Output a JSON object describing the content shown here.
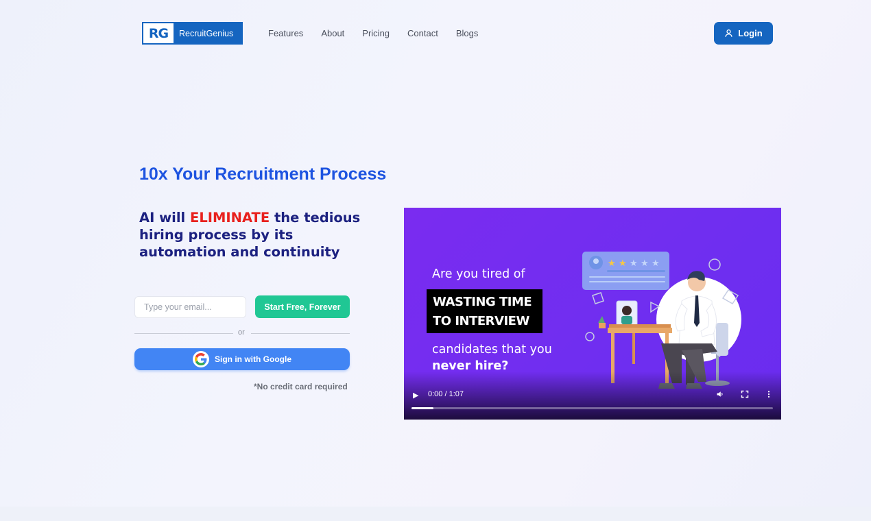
{
  "brand": {
    "logo_mark": "RG",
    "name": "RecruitGenius",
    "primary_color": "#1565c0"
  },
  "nav": {
    "items": [
      "Features",
      "About",
      "Pricing",
      "Contact",
      "Blogs"
    ]
  },
  "header": {
    "login_label": "Login"
  },
  "hero": {
    "title": "10x Your Recruitment Process",
    "subtitle_pre": "AI will ",
    "subtitle_highlight": "ELIMINATE",
    "subtitle_post": " the tedious hiring process by its automation and continuity",
    "email_placeholder": "Type your email...",
    "start_label": "Start Free, Forever",
    "or_text": "or",
    "google_label": "Sign in with Google",
    "no_cc": "*No credit card required",
    "start_color": "#20c794",
    "google_color": "#4285f4",
    "highlight_color": "#e8201d"
  },
  "video": {
    "line1": "Are you tired of",
    "box_line1": "WASTING TIME",
    "box_line2": "TO INTERVIEW",
    "line3_pre": "candidates that you ",
    "line3_bold": "never hire?",
    "time": "0:00 / 1:07",
    "progress": 0.06,
    "background_color": "#7a2cf0"
  }
}
